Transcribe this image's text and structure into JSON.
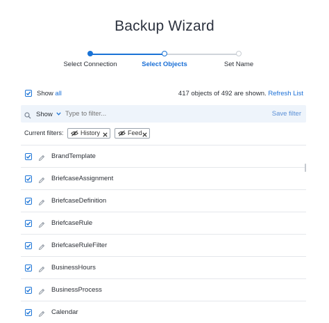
{
  "title": "Backup Wizard",
  "steps": [
    {
      "label": "Select Connection",
      "state": "done"
    },
    {
      "label": "Select Objects",
      "state": "active"
    },
    {
      "label": "Set Name",
      "state": "pending"
    }
  ],
  "toolbar": {
    "show_label": "Show",
    "all_link": "all",
    "count_text": "417 objects of 492 are shown.",
    "refresh_link": "Refresh List"
  },
  "filter": {
    "show_dropdown": "Show",
    "placeholder": "Type to filter...",
    "save_filter": "Save filter"
  },
  "current_filters": {
    "label": "Current filters:",
    "chips": [
      "History",
      "Feed"
    ]
  },
  "objects": [
    "BrandTemplate",
    "BriefcaseAssignment",
    "BriefcaseDefinition",
    "BriefcaseRule",
    "BriefcaseRuleFilter",
    "BusinessHours",
    "BusinessProcess",
    "Calendar"
  ],
  "colors": {
    "accent": "#1a73d6",
    "step_done": "#1a73d6",
    "step_pending": "#c8cdd3",
    "filterbar_bg": "#eef4fb"
  }
}
